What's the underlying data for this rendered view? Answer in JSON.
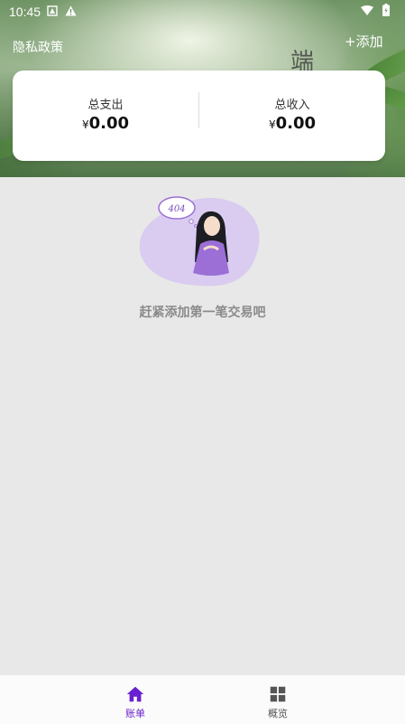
{
  "status_bar": {
    "time": "10:45"
  },
  "header": {
    "privacy_label": "隐私政策",
    "add_label": "+添加",
    "decor_char": "端"
  },
  "summary": {
    "expense_label": "总支出",
    "expense_currency": "¥",
    "expense_value": "0.00",
    "income_label": "总收入",
    "income_currency": "¥",
    "income_value": "0.00"
  },
  "empty_state": {
    "badge_text": "404",
    "message": "赶紧添加第一笔交易吧"
  },
  "tabs": [
    {
      "label": "账单",
      "icon": "home-icon",
      "active": true
    },
    {
      "label": "概览",
      "icon": "grid-icon",
      "active": false
    }
  ],
  "colors": {
    "accent": "#6a1fd0",
    "inactive": "#555555",
    "blob": "#d9ccf0",
    "dress": "#9b6fd6"
  }
}
